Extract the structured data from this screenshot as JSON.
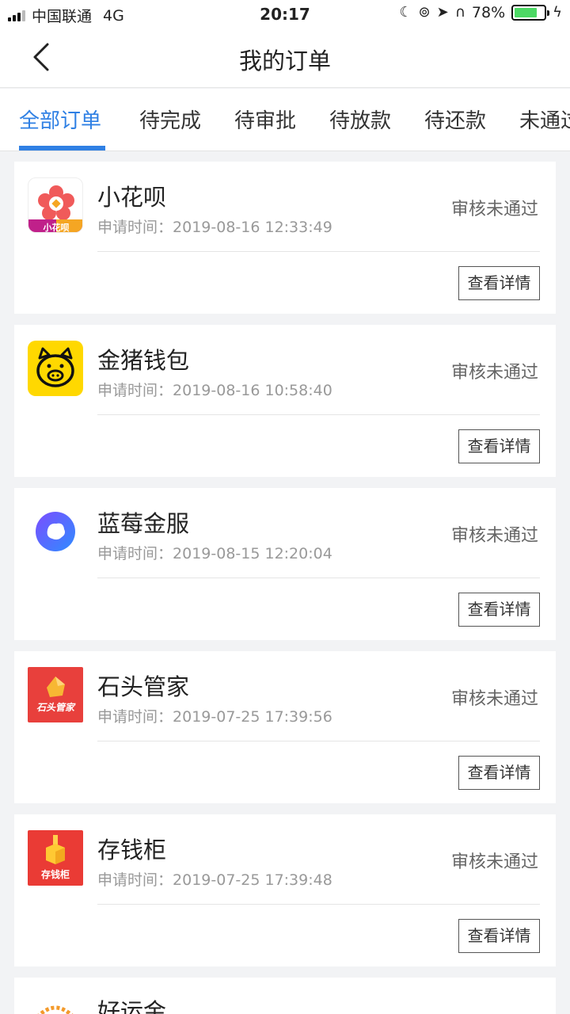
{
  "status_bar": {
    "carrier": "中国联通",
    "network": "4G",
    "time": "20:17",
    "battery": "78%",
    "battery_level": 0.78
  },
  "nav": {
    "title": "我的订单",
    "back_icon": "chevron-left-icon"
  },
  "tabs": [
    {
      "label": "全部订单"
    },
    {
      "label": "待完成"
    },
    {
      "label": "待审批"
    },
    {
      "label": "待放款"
    },
    {
      "label": "待还款"
    },
    {
      "label": "未通过"
    }
  ],
  "active_tab": "全部订单",
  "colors": {
    "accent": "#2f80e4",
    "background": "#f2f3f5"
  },
  "time_label": "申请时间：",
  "detail_label": "查看详情",
  "orders": [
    {
      "name": "小花呗",
      "time": "2019-08-16 12:33:49",
      "status": "审核未通过",
      "logo_text": "小花呗"
    },
    {
      "name": "金猪钱包",
      "time": "2019-08-16 10:58:40",
      "status": "审核未通过"
    },
    {
      "name": "蓝莓金服",
      "time": "2019-08-15 12:20:04",
      "status": "审核未通过"
    },
    {
      "name": "石头管家",
      "time": "2019-07-25 17:39:56",
      "status": "审核未通过",
      "logo_text": "石头管家"
    },
    {
      "name": "存钱柜",
      "time": "2019-07-25 17:39:48",
      "status": "审核未通过",
      "logo_text": "存钱柜"
    },
    {
      "name": "好运金"
    }
  ]
}
